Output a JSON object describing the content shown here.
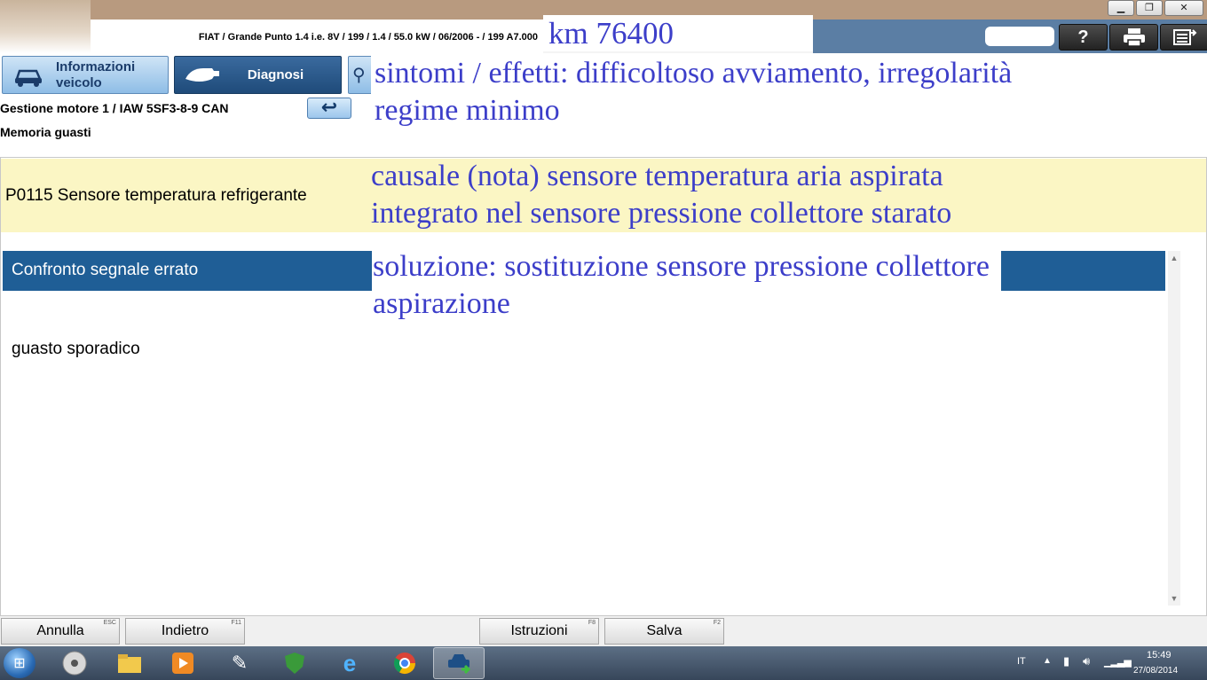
{
  "header": {
    "vehicle_info": "FIAT / Grande Punto 1.4 i.e. 8V / 199 / 1.4 / 55.0 kW / 06/2006 - / 199 A7.000",
    "km_note": "km 76400",
    "help_icon": "?",
    "print_icon": "printer-icon",
    "menu_icon": "menu-exit-icon"
  },
  "window_controls": {
    "minimize": "▁",
    "restore": "❐",
    "close": "✕"
  },
  "tabs": {
    "info": "Informazioni veicolo",
    "diagnosi": "Diagnosi"
  },
  "breadcrumb": {
    "ecu": "Gestione motore 1 / IAW 5SF3-8-9 CAN",
    "section": "Memoria guasti",
    "back_icon": "↩"
  },
  "notes": {
    "sintomi": "sintomi / effetti: difficoltoso avviamento, irregolarità regime minimo",
    "causale": "causale (nota) sensore temperatura aria aspirata integrato nel sensore pressione collettore starato",
    "soluzione": "soluzione: sostituzione sensore pressione collettore aspirazione"
  },
  "fault": {
    "code_text": "P0115  Sensore temperatura refrigerante",
    "signal": "Confronto segnale errato",
    "type": "guasto sporadico"
  },
  "buttons": {
    "annulla": "Annulla",
    "annulla_key": "ESC",
    "indietro": "Indietro",
    "indietro_key": "F11",
    "istruzioni": "Istruzioni",
    "istruzioni_key": "F8",
    "salva": "Salva",
    "salva_key": "F2"
  },
  "taskbar": {
    "language": "IT",
    "time": "15:49",
    "date": "27/08/2014"
  }
}
